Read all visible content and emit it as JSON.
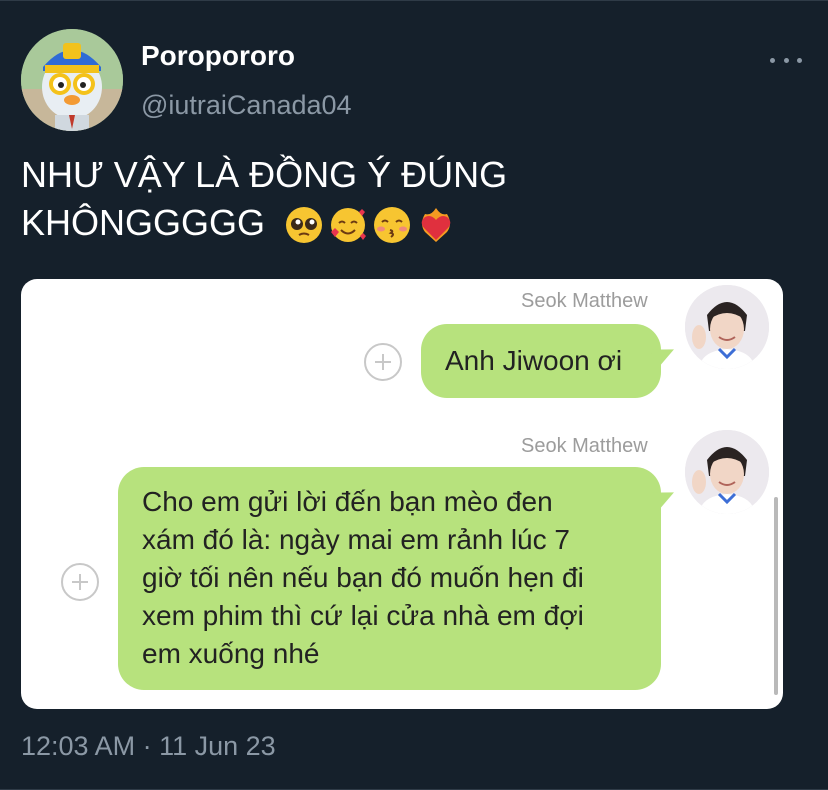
{
  "tweet": {
    "display_name": "Poropororo",
    "handle": "@iutraiCanada04",
    "text_line1": "NHƯ VẬY LÀ ĐỒNG Ý ĐÚNG",
    "text_line2": "KHÔNGGGGG",
    "emojis": [
      "pleading-face",
      "smiling-face-with-hearts",
      "kissing-face-closed-eyes",
      "heart-on-fire"
    ],
    "timestamp": "12:03 AM · 11 Jun 23"
  },
  "chat": {
    "messages": [
      {
        "sender": "Seok Matthew",
        "text": "Anh Jiwoon ơi"
      },
      {
        "sender": "Seok Matthew",
        "lines": [
          "Cho em gửi lời đến bạn mèo đen",
          "xám đó là: ngày mai em rảnh lúc 7",
          "giờ tối nên nếu bạn đó muốn hẹn đi",
          "xem phim thì cứ lại cửa nhà em đợi",
          "em xuống nhé"
        ]
      }
    ]
  },
  "colors": {
    "background": "#15202b",
    "bubble": "#b7e27d",
    "secondary_text": "#8b98a5"
  }
}
